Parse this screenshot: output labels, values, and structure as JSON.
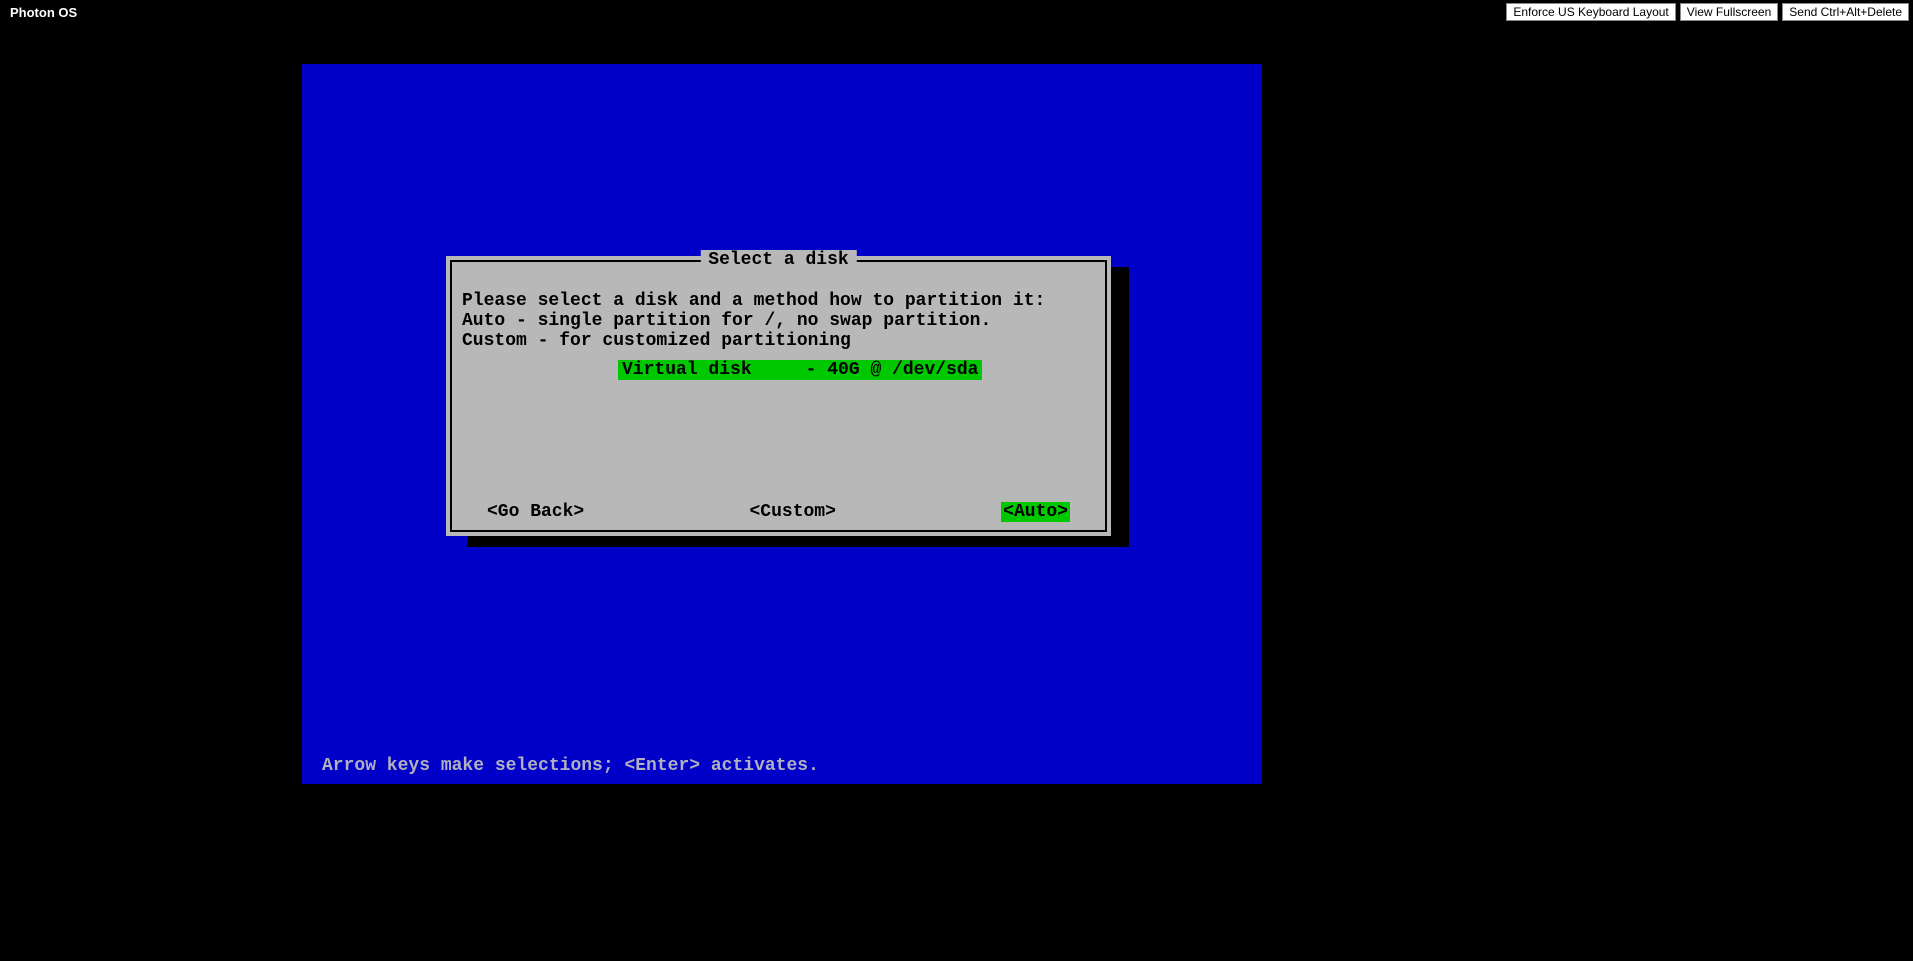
{
  "header": {
    "title": "Photon OS",
    "buttons": {
      "keyboard": "Enforce US Keyboard Layout",
      "fullscreen": "View Fullscreen",
      "ctrlaltdel": "Send Ctrl+Alt+Delete"
    }
  },
  "dialog": {
    "title": " Select a disk ",
    "line1": "Please select a disk and a method how to partition it:",
    "line2": "Auto - single partition for /, no swap partition.",
    "line3": "Custom - for customized partitioning",
    "disk_entry": "Virtual disk     - 40G @ /dev/sda",
    "buttons": {
      "back": "<Go Back>",
      "custom": "<Custom>",
      "auto": "<Auto>"
    }
  },
  "footer": "Arrow keys make selections; <Enter> activates."
}
